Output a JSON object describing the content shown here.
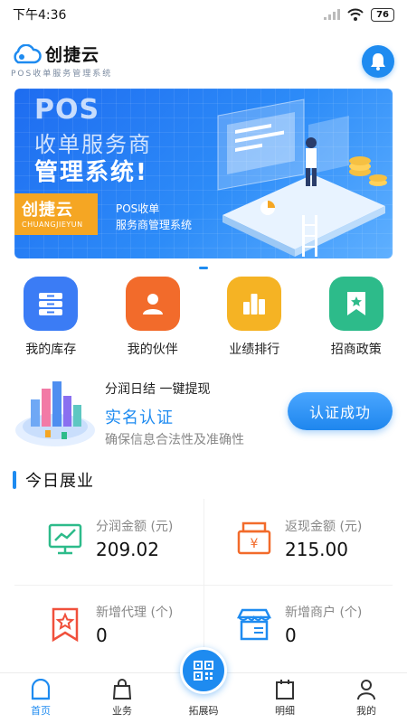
{
  "status_bar": {
    "time": "下午4:36",
    "battery": "76"
  },
  "header": {
    "app_name": "创捷云",
    "subtitle": "POS收单服务管理系统"
  },
  "banner": {
    "line_pos": "POS",
    "line_1": "收单服务商",
    "line_2": "管理系统!",
    "tag_cn": "创捷云",
    "tag_en": "CHUANGJIEYUN",
    "desc_1": "POS收单",
    "desc_2": "服务商管理系统"
  },
  "quick_menu": [
    {
      "label": "我的库存",
      "color": "#3b7cf5"
    },
    {
      "label": "我的伙伴",
      "color": "#f26b2b"
    },
    {
      "label": "业绩排行",
      "color": "#f5b324"
    },
    {
      "label": "招商政策",
      "color": "#2dbb8a"
    }
  ],
  "verify": {
    "line_1": "分润日结  一键提现",
    "line_2": "实名认证",
    "line_3": "确保信息合法性及准确性",
    "button": "认证成功"
  },
  "section_title": "今日展业",
  "stats": [
    {
      "label": "分润金额 (元)",
      "value": "209.02",
      "icon": "trend-chart-icon",
      "color": "#2dbb8a"
    },
    {
      "label": "返现金额 (元)",
      "value": "215.00",
      "icon": "cash-register-icon",
      "color": "#f26b2b"
    },
    {
      "label": "新增代理 (个)",
      "value": "0",
      "icon": "star-ribbon-icon",
      "color": "#f0503c"
    },
    {
      "label": "新增商户 (个)",
      "value": "0",
      "icon": "shop-icon",
      "color": "#1e8bf0"
    }
  ],
  "bottom_nav": [
    {
      "label": "首页",
      "active": true
    },
    {
      "label": "业务",
      "active": false
    },
    {
      "label": "拓展码",
      "active": false
    },
    {
      "label": "明细",
      "active": false
    },
    {
      "label": "我的",
      "active": false
    }
  ],
  "colors": {
    "accent": "#1e8bf0",
    "banner_tag": "#f5a623"
  }
}
